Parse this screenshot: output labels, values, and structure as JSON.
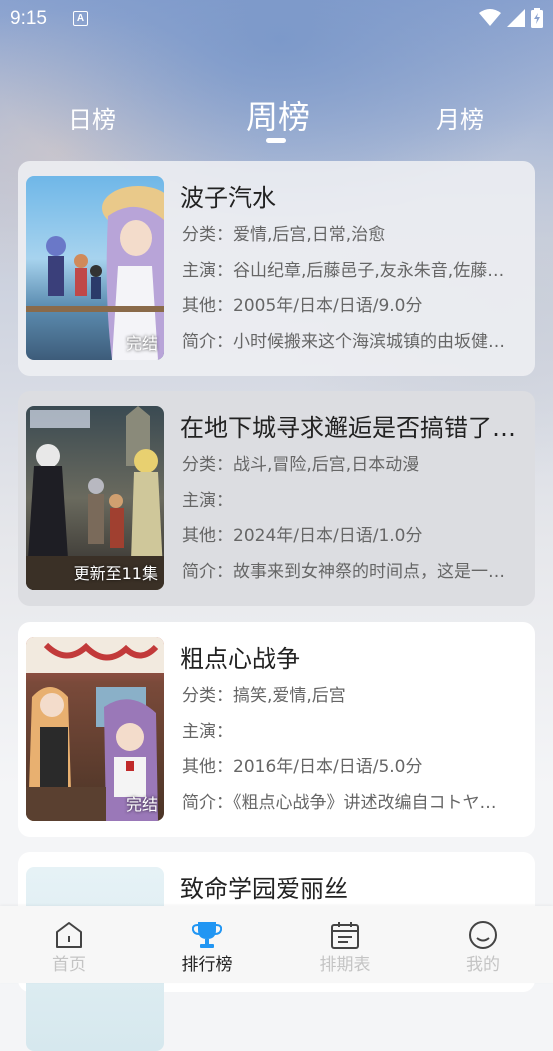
{
  "status_bar": {
    "time": "9:15",
    "notification_icon_letter": "A"
  },
  "tabs": [
    {
      "label": "日榜",
      "active": false
    },
    {
      "label": "周榜",
      "active": true
    },
    {
      "label": "月榜",
      "active": false
    }
  ],
  "items": [
    {
      "title": "波子汽水",
      "category": "分类：爱情,后宫,日常,治愈",
      "cast": "主演：谷山纪章,后藤邑子,友永朱音,佐藤…",
      "other": "其他：2005年/日本/日语/9.0分",
      "intro": "简介：小时候搬来这个海滨城镇的由坂健…",
      "badge": "完结"
    },
    {
      "title": "在地下城寻求邂逅是否搞错了…",
      "category": "分类：战斗,冒险,后宫,日本动漫",
      "cast": "主演：",
      "other": "其他：2024年/日本/日语/1.0分",
      "intro": "简介：故事来到女神祭的时间点，这是一…",
      "badge": "更新至11集"
    },
    {
      "title": "粗点心战争",
      "category": "分类：搞笑,爱情,后宫",
      "cast": "主演：",
      "other": "其他：2016年/日本/日语/5.0分",
      "intro": "简介：《粗点心战争》讲述改编自コトヤ…",
      "badge": "完结"
    },
    {
      "title": "致命学园爱丽丝"
    }
  ],
  "bottom_nav": [
    {
      "label": "首页",
      "icon": "home-icon",
      "active": false
    },
    {
      "label": "排行榜",
      "icon": "trophy-icon",
      "active": true
    },
    {
      "label": "排期表",
      "icon": "calendar-icon",
      "active": false
    },
    {
      "label": "我的",
      "icon": "smile-icon",
      "active": false
    }
  ],
  "colors": {
    "accent": "#2196f3",
    "inactive": "#c4c4c4",
    "text_primary": "#222222",
    "text_secondary": "#666666"
  }
}
